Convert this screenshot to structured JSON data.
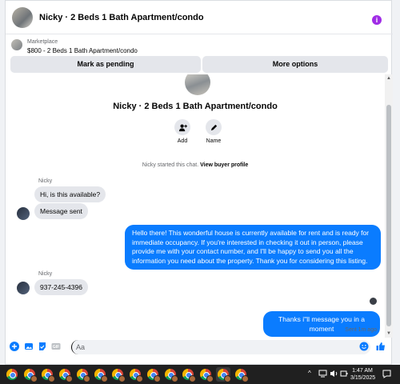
{
  "header": {
    "title": "Nicky · 2 Beds 1 Bath Apartment/condo",
    "info_glyph": "i",
    "info_color": "#a02ce6"
  },
  "listing": {
    "kicker": "Marketplace",
    "title": "$800 - 2 Beds 1 Bath Apartment/condo"
  },
  "actions": {
    "pending_label": "Mark as pending",
    "more_label": "More options"
  },
  "profile": {
    "name": "Nicky · 2 Beds 1 Bath Apartment/condo",
    "add_label": "Add",
    "name_label": "Name",
    "started_text": "Nicky started this chat.",
    "view_profile": "View buyer profile"
  },
  "messages": {
    "group1_sender": "Nicky",
    "m1": "Hi, is this available?",
    "m2": "Message sent",
    "m3": "Hello there! This wonderful house is currently available for rent and is ready for immediate occupancy. If you're interested in checking it out in person, please provide me with your contact number, and I'll be happy to send you all the information you need about the property. Thank you for considering this listing.",
    "group2_sender": "Nicky",
    "m4": "937-245-4396",
    "m5": "Thanks i\"ll message you in a moment",
    "sent_status": "Sent 1m ago"
  },
  "composer": {
    "placeholder": "Aa",
    "accent": "#0a7cff"
  },
  "taskbar": {
    "time": "1:47 AM",
    "date": "3/15/2025"
  },
  "colors": {
    "outgoing_bubble": "#0a7cff",
    "incoming_bubble": "#e4e6eb",
    "taskbar": "#202020"
  }
}
